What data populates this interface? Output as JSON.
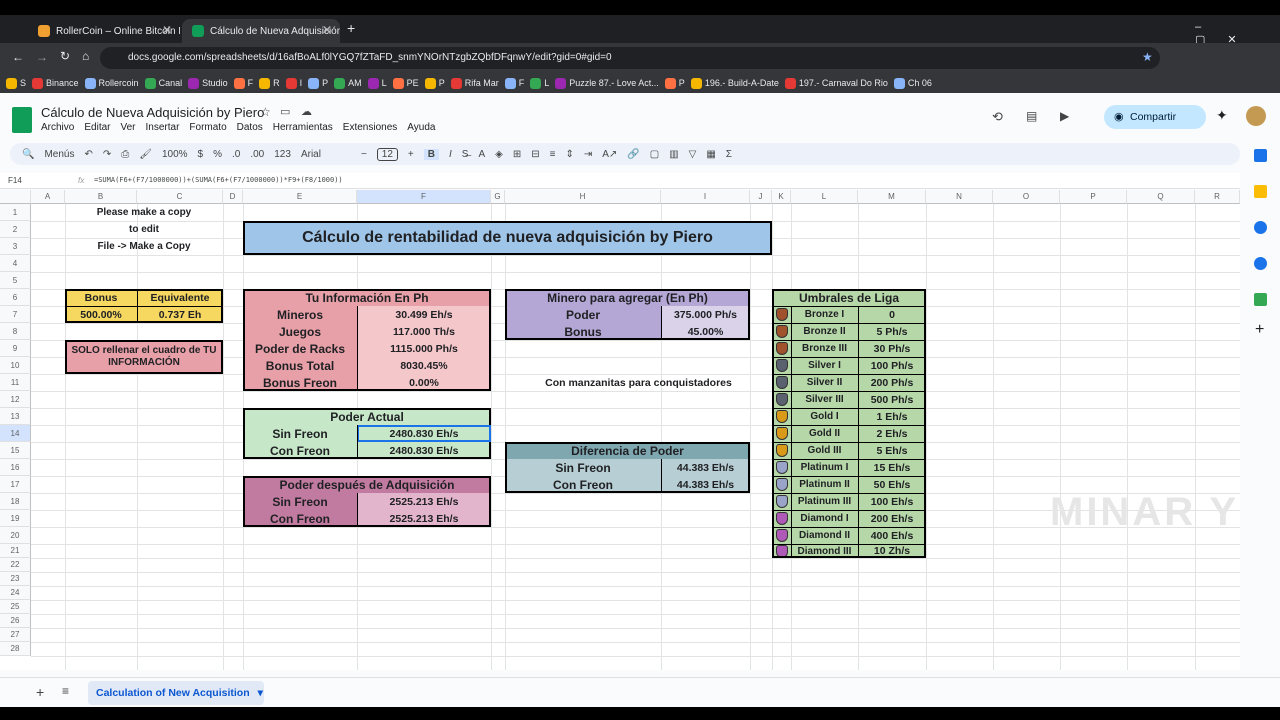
{
  "browser": {
    "tabs": [
      {
        "title": "RollerCoin – Online Bitcoin Mini..."
      },
      {
        "title": "Cálculo de Nueva Adquisición b..."
      }
    ],
    "url": "docs.google.com/spreadsheets/d/16afBoALf0lYGQ7fZTaFD_snmYNOrNTzgbZQbfDFqnwY/edit?gid=0#gid=0",
    "bookmarks": [
      "S",
      "Binance",
      "Rollercoin",
      "Canal",
      "Studio",
      "F",
      "R",
      "I",
      "P",
      "AM",
      "L",
      "PE",
      "P",
      "Rifa Mar",
      "F",
      "L",
      "Puzzle 87.- Love Act...",
      "P",
      "196.- Build-A-Date",
      "197.- Carnaval Do Rio",
      "Ch 06"
    ]
  },
  "doc": {
    "title": "Cálculo de Nueva Adquisición by Piero",
    "menus": [
      "Archivo",
      "Editar",
      "Ver",
      "Insertar",
      "Formato",
      "Datos",
      "Herramientas",
      "Extensiones",
      "Ayuda"
    ],
    "share_label": "Compartir"
  },
  "toolbar": {
    "menus_label": "Menús",
    "zoom": "100%",
    "currency": "$",
    "percent": "%",
    "decimals_less": ".0",
    "decimals_more": ".00",
    "format_123": "123",
    "font": "Arial",
    "font_size": "12",
    "bold": "B",
    "italic": "I",
    "minus": "−",
    "plus": "+"
  },
  "formula": {
    "cell_ref": "F14",
    "fx": "fx",
    "text": "=SUMA(F6+(F7/1000000))+(SUMA(F6+(F7/1000000))*F9+(F8/1000))"
  },
  "columns": [
    "A",
    "B",
    "C",
    "D",
    "E",
    "F",
    "G",
    "H",
    "I",
    "J",
    "K",
    "L",
    "M",
    "N",
    "O",
    "P",
    "Q",
    "R"
  ],
  "rows": [
    "1",
    "2",
    "3",
    "4",
    "5",
    "6",
    "7",
    "8",
    "9",
    "10",
    "11",
    "12",
    "13",
    "14",
    "15",
    "16",
    "17",
    "18",
    "19",
    "20",
    "21",
    "22",
    "23",
    "24",
    "25",
    "26",
    "27",
    "28"
  ],
  "sheet": {
    "copy_note": [
      "Please make a copy",
      "to edit",
      "File -> Make a Copy"
    ],
    "main_title": "Cálculo de rentabilidad de nueva adquisición by Piero",
    "bonus": {
      "h1": "Bonus",
      "h2": "Equivalente",
      "v1": "500.00%",
      "v2": "0.737 Eh"
    },
    "fill_note": "SOLO rellenar el cuadro de TU INFORMACIÓN",
    "info": {
      "title": "Tu Información En Ph",
      "rows": [
        {
          "label": "Mineros",
          "value": "30.499 Eh/s"
        },
        {
          "label": "Juegos",
          "value": "117.000 Th/s"
        },
        {
          "label": "Poder de Racks",
          "value": "1115.000 Ph/s"
        },
        {
          "label": "Bonus Total",
          "value": "8030.45%"
        },
        {
          "label": "Bonus Freon",
          "value": "0.00%"
        }
      ]
    },
    "current": {
      "title": "Poder Actual",
      "rows": [
        {
          "label": "Sin Freon",
          "value": "2480.830 Eh/s"
        },
        {
          "label": "Con Freon",
          "value": "2480.830 Eh/s"
        }
      ]
    },
    "after": {
      "title": "Poder después de Adquisición",
      "rows": [
        {
          "label": "Sin Freon",
          "value": "2525.213 Eh/s"
        },
        {
          "label": "Con Freon",
          "value": "2525.213 Eh/s"
        }
      ]
    },
    "miner": {
      "title": "Minero para agregar (En Ph)",
      "rows": [
        {
          "label": "Poder",
          "value": "375.000 Ph/s"
        },
        {
          "label": "Bonus",
          "value": "45.00%"
        }
      ]
    },
    "apples": "Con manzanitas para conquistadores",
    "diff": {
      "title": "Diferencia de Poder",
      "rows": [
        {
          "label": "Sin Freon",
          "value": "44.383 Eh/s"
        },
        {
          "label": "Con Freon",
          "value": "44.383 Eh/s"
        }
      ]
    },
    "league": {
      "title": "Umbrales de Liga",
      "rows": [
        {
          "name": "Bronze I",
          "value": "0",
          "color": "#a0522d"
        },
        {
          "name": "Bronze II",
          "value": "5 Ph/s",
          "color": "#a0522d"
        },
        {
          "name": "Bronze III",
          "value": "30 Ph/s",
          "color": "#a0522d"
        },
        {
          "name": "Silver I",
          "value": "100 Ph/s",
          "color": "#5a6270"
        },
        {
          "name": "Silver II",
          "value": "200 Ph/s",
          "color": "#5a6270"
        },
        {
          "name": "Silver III",
          "value": "500 Ph/s",
          "color": "#5a6270"
        },
        {
          "name": "Gold I",
          "value": "1 Eh/s",
          "color": "#d99a1a"
        },
        {
          "name": "Gold II",
          "value": "2 Eh/s",
          "color": "#d99a1a"
        },
        {
          "name": "Gold III",
          "value": "5 Eh/s",
          "color": "#d99a1a"
        },
        {
          "name": "Platinum I",
          "value": "15 Eh/s",
          "color": "#9aa3c8"
        },
        {
          "name": "Platinum II",
          "value": "50 Eh/s",
          "color": "#9aa3c8"
        },
        {
          "name": "Platinum III",
          "value": "100 Eh/s",
          "color": "#9aa3c8"
        },
        {
          "name": "Diamond I",
          "value": "200 Eh/s",
          "color": "#b05ab8"
        },
        {
          "name": "Diamond II",
          "value": "400 Eh/s",
          "color": "#b05ab8"
        },
        {
          "name": "Diamond III",
          "value": "10 Zh/s",
          "color": "#b05ab8"
        }
      ]
    }
  },
  "sheet_tab": "Calculation of New Acquisition",
  "watermark": "MINAR Y",
  "colors": {
    "yellow": "#f6d860",
    "pink": "#e8a0a8",
    "pink_light": "#f4c7cb",
    "green": "#c7e7c9",
    "purple": "#b4a7d6",
    "purple_light": "#d9d2e9",
    "teal": "#7fa7b0",
    "teal_light": "#b7cfd4",
    "blue_title": "#9fc5e8",
    "magenta": "#c27ba0",
    "magenta_light": "#e3b5cc",
    "league_green": "#b6d7a8"
  }
}
